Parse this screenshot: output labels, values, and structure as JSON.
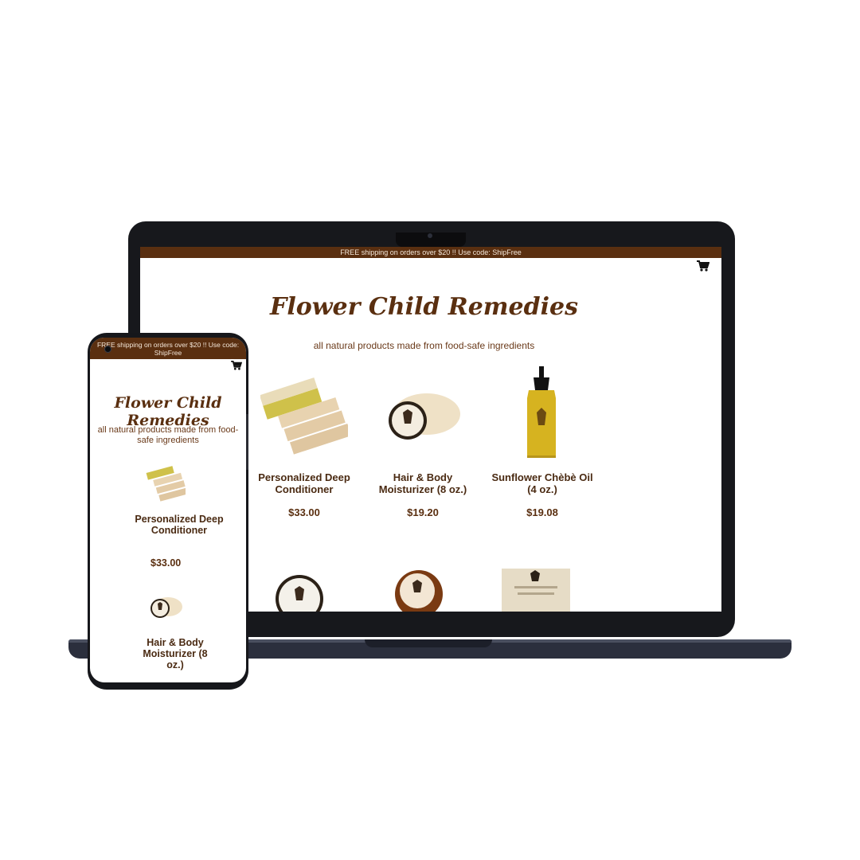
{
  "desktop": {
    "announcement": "FREE shipping on orders over $20 !! Use code: ShipFree",
    "cart_icon": "cart-icon",
    "brand": "Flower Child Remedies",
    "tagline": "all natural products made from food-safe ingredients",
    "products": [
      {
        "name": "Personalized Deep Conditioner",
        "price": "$33.00",
        "image": "conditioner-packets-image"
      },
      {
        "name": "Hair & Body Moisturizer (8 oz.)",
        "price": "$19.20",
        "image": "moisturizer-jar-image"
      },
      {
        "name": "Sunflower Chèbè Oil (4 oz.)",
        "price": "$19.08",
        "image": "oil-bottle-image"
      }
    ]
  },
  "mobile": {
    "announcement": "FREE shipping on orders over $20 !! Use code: ShipFree",
    "cart_icon": "cart-icon",
    "brand": "Flower Child Remedies",
    "tagline": "all natural products made from food-safe ingredients",
    "products": [
      {
        "name": "Personalized Deep Conditioner",
        "price": "$33.00",
        "image": "conditioner-packets-image"
      },
      {
        "name": "Hair & Body Moisturizer (8 oz.)",
        "price": "",
        "image": "moisturizer-jar-image"
      }
    ]
  },
  "colors": {
    "brand_brown": "#5a2f10",
    "device_frame": "#17181c"
  }
}
